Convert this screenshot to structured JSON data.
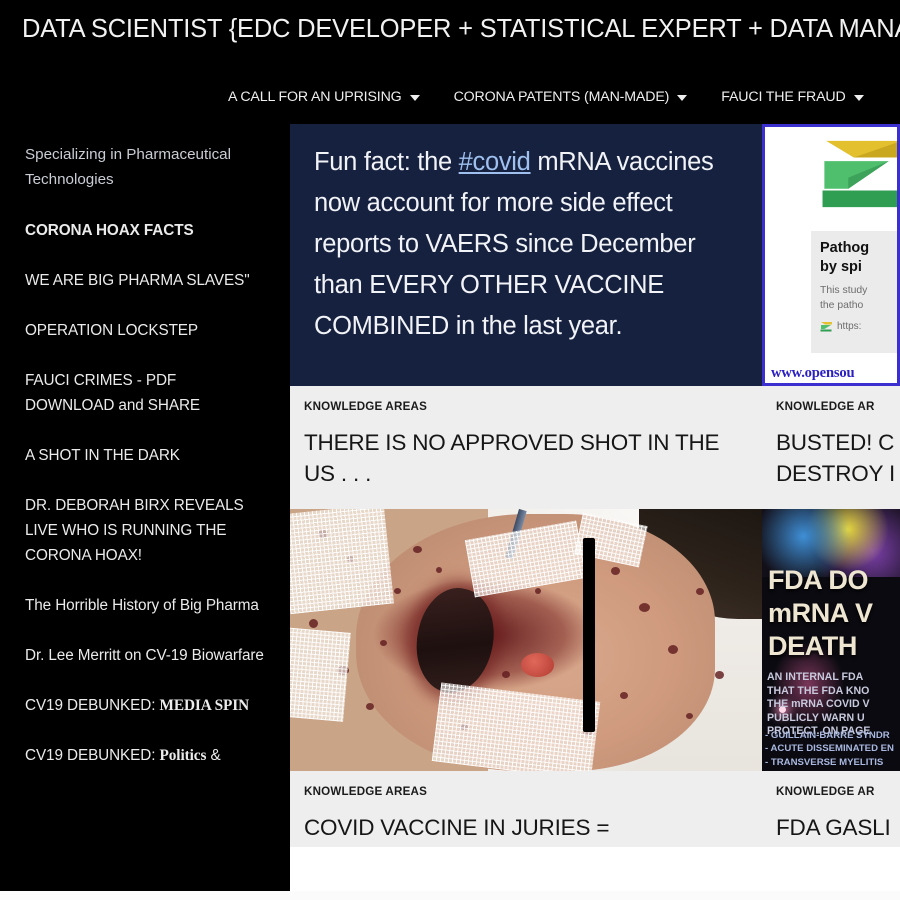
{
  "header": {
    "site_title": "DATA SCIENTIST {EDC DEVELOPER + STATISTICAL EXPERT + DATA MANAGER}",
    "nav": [
      {
        "label": "A CALL FOR AN UPRISING",
        "caret": "chevron-down-icon"
      },
      {
        "label": "CORONA PATENTS (MAN-MADE)",
        "caret": "chevron-down-icon"
      },
      {
        "label": "FAUCI THE FRAUD",
        "caret": "chevron-down-icon"
      }
    ]
  },
  "sidebar": {
    "tagline": "Specializing in Pharmaceutical Technologies",
    "items": [
      {
        "label": "CORONA HOAX FACTS",
        "active": true
      },
      {
        "label": "WE ARE BIG PHARMA SLAVES\"",
        "active": false
      },
      {
        "label": "OPERATION LOCKSTEP",
        "active": false
      },
      {
        "label": "FAUCI CRIMES - PDF DOWNLOAD and SHARE",
        "active": false
      },
      {
        "label": "A SHOT IN THE DARK",
        "active": false
      },
      {
        "label": "DR. DEBORAH BIRX REVEALS LIVE WHO IS RUNNING THE CORONA HOAX!",
        "active": false
      },
      {
        "label": "The Horrible History of Big Pharma",
        "active": false
      },
      {
        "label": "Dr. Lee Merritt on CV-19 Biowarfare",
        "active": false
      },
      {
        "label": "CV19 DEBUNKED: MEDIA SPIN",
        "active": false,
        "bold_tail": "MEDIA SPIN",
        "plain_head": "CV19 DEBUNKED: "
      },
      {
        "label": "CV19 DEBUNKED: Politics &",
        "active": false,
        "bold_tail": "Politics",
        "plain_head": "CV19 DEBUNKED: ",
        "plain_tail": " &"
      }
    ]
  },
  "cards": {
    "row1": [
      {
        "kicker": "KNOWLEDGE AREAS",
        "title": "THERE IS NO APPROVED SHOT IN THE US . . .",
        "media": {
          "kind": "tweet",
          "text_before": "Fun fact: the ",
          "link": "#covid",
          "text_after": " mRNA vaccines now account for more side effect reports to VAERS since December than EVERY OTHER VACCINE COMBINED in the last year.",
          "bg": "#16213f"
        }
      },
      {
        "kicker": "KNOWLEDGE AR",
        "title_line1": "BUSTED! C",
        "title_line2": "DESTROY I",
        "media": {
          "kind": "zenodo",
          "heading_line1": "Pathog",
          "heading_line2": "by spi",
          "sub_line1": "This study",
          "sub_line2": "the patho",
          "url_text": "https:",
          "footer": "www.opensou",
          "border_color": "#3b2fcf",
          "footer_color": "#2a1fc0"
        }
      }
    ],
    "row2": [
      {
        "kicker": "KNOWLEDGE AREAS",
        "title": "COVID VACCINE IN JURIES =",
        "media": {
          "kind": "clinical-photo"
        }
      },
      {
        "kicker": "KNOWLEDGE AR",
        "title": "FDA GASLI",
        "media": {
          "kind": "fda-poster",
          "head_line1": "FDA DO",
          "head_line2": "mRNA V",
          "head_line3": "DEATH",
          "body_line1": "AN INTERNAL FDA",
          "body_line2": "THAT THE FDA KNO",
          "body_line3": "THE mRNA COVID V",
          "body_line4": "PUBLICLY WARN U",
          "body_line5": "PROTECT. ON PAGE",
          "list_line1": "- GUILLAIN-BARRÉ SYNDR",
          "list_line2": "- ACUTE DISSEMINATED EN",
          "list_line3": "- TRANSVERSE MYELITIS"
        }
      }
    ]
  },
  "colors": {
    "page_bg": "#000000",
    "card_bg": "#eeeeee",
    "text_light": "#ebebeb",
    "tweet_bg": "#16213f",
    "tweet_link": "#9fc0ef"
  }
}
